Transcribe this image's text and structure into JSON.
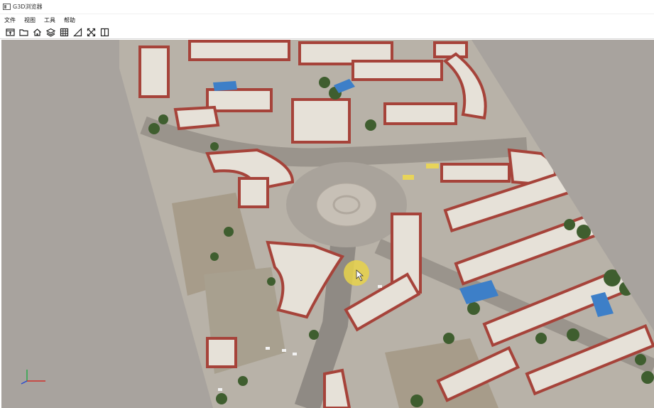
{
  "window": {
    "title": "G3D浏览器",
    "icon": "app-window-icon"
  },
  "menu": {
    "items": [
      "文件",
      "视图",
      "工具",
      "帮助"
    ]
  },
  "toolbar": {
    "icons": [
      "open-model-icon",
      "folder-icon",
      "home-icon",
      "layers-icon",
      "grid-icon",
      "measure-icon",
      "fullscreen-icon",
      "split-view-icon"
    ]
  },
  "viewport": {
    "background": "#a8a39e",
    "content": "3d-city-model"
  },
  "colors": {
    "ground": "#b8b2a8",
    "roof": "#e6e1d8",
    "wall": "#a6433a",
    "tree": "#3f5e2f",
    "road": "#8f8a84",
    "cursor_highlight": "#e8d24a"
  }
}
